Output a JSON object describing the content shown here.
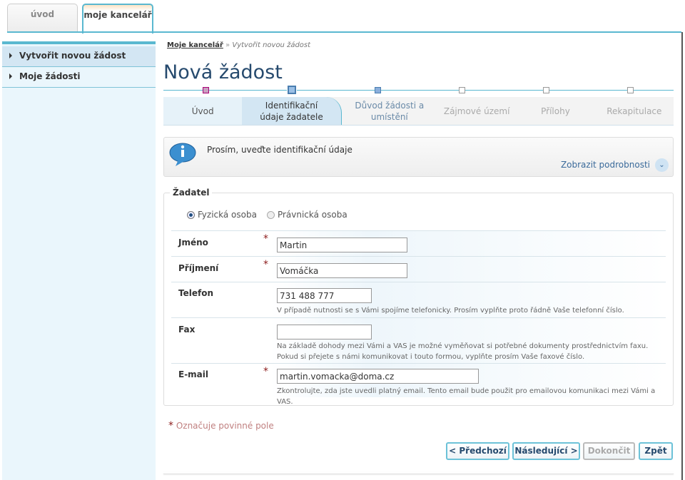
{
  "top_tabs": [
    {
      "label": "úvod"
    },
    {
      "label": "moje kancelář"
    }
  ],
  "sidebar": {
    "items": [
      {
        "label": "Vytvořit novou žádost"
      },
      {
        "label": "Moje žádosti"
      }
    ]
  },
  "breadcrumb": {
    "parent": "Moje kancelář",
    "separator": "»",
    "current": "Vytvořit novou žádost"
  },
  "page_title": "Nová žádost",
  "steps": [
    {
      "label": "Úvod"
    },
    {
      "label": "Identifikační údaje žadatele"
    },
    {
      "label": "Důvod žádosti a umístění"
    },
    {
      "label": "Zájmové území"
    },
    {
      "label": "Přílohy"
    },
    {
      "label": "Rekapitulace"
    }
  ],
  "info": {
    "message": "Prosím, uveďte identifikační údaje",
    "details_link": "Zobrazit podrobnosti"
  },
  "form": {
    "legend": "Žadatel",
    "person_type": {
      "options": [
        "Fyzická osoba",
        "Právnická osoba"
      ],
      "selected": "Fyzická osoba"
    },
    "fields": [
      {
        "label": "Jméno",
        "value": "Martin",
        "required": true
      },
      {
        "label": "Příjmení",
        "value": "Vomáčka",
        "required": true
      },
      {
        "label": "Telefon",
        "value": "731 488 777",
        "help": "V případě nutnosti se s Vámi spojíme telefonicky. Prosím vyplňte proto řádně Vaše telefonní číslo."
      },
      {
        "label": "Fax",
        "value": "",
        "help": "Na základě dohody mezi Vámi a VAS je možné vyměňovat si potřebné dokumenty prostřednictvím faxu. Pokud si přejete s námi komunikovat i touto formou, vyplňte prosím Vaše faxové číslo."
      },
      {
        "label": "E-mail",
        "value": "martin.vomacka@doma.cz",
        "required": true,
        "help": "Zkontrolujte, zda jste uvedli platný email. Tento email bude použit pro emailovou komunikaci mezi Vámi a VAS."
      }
    ]
  },
  "required_note": "Označuje povinné pole",
  "buttons": {
    "prev": "< Předchozí",
    "next": "Následující >",
    "finish": "Dokončit",
    "back": "Zpět"
  },
  "colors": {
    "accent": "#5ab8d0",
    "title": "#264a6e",
    "required": "#8b1a1a"
  }
}
